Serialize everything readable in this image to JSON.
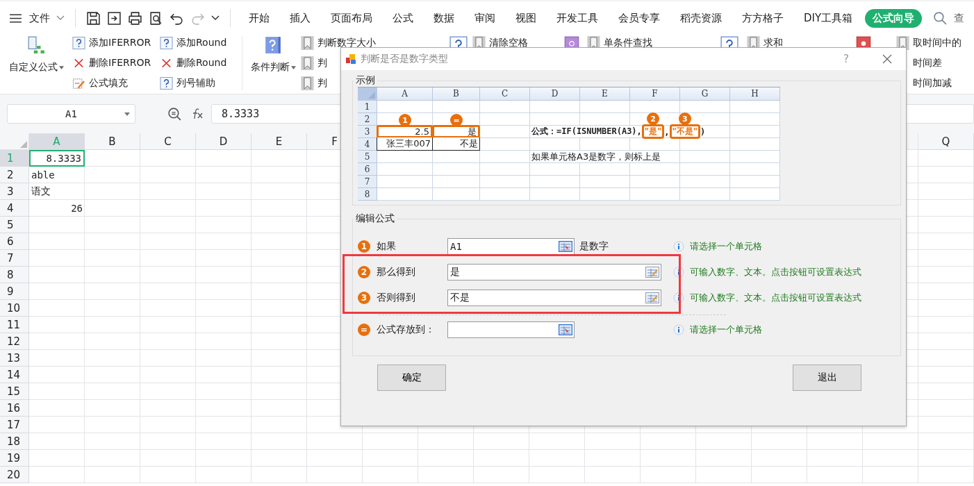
{
  "menu_bar": {
    "file_menu": "文件",
    "tabs": [
      {
        "label": "开始",
        "selected": false
      },
      {
        "label": "插入",
        "selected": false
      },
      {
        "label": "页面布局",
        "selected": false
      },
      {
        "label": "公式",
        "selected": false
      },
      {
        "label": "数据",
        "selected": false
      },
      {
        "label": "审阅",
        "selected": false
      },
      {
        "label": "视图",
        "selected": false
      },
      {
        "label": "开发工具",
        "selected": false
      },
      {
        "label": "会员专享",
        "selected": false
      },
      {
        "label": "稻壳资源",
        "selected": false
      },
      {
        "label": "方方格子",
        "selected": false
      },
      {
        "label": "DIY工具箱",
        "selected": false
      },
      {
        "label": "公式向导",
        "selected": true
      }
    ],
    "search_label": "查"
  },
  "ribbon": {
    "custom_formula": "自定义公式",
    "condition": "条件判断",
    "small_columns": [
      [
        {
          "kind": "help",
          "label": "添加IFERROR"
        },
        {
          "kind": "delete",
          "label": "删除IFERROR"
        },
        {
          "kind": "fill",
          "label": "公式填充"
        }
      ],
      [
        {
          "kind": "help",
          "label": "添加Round"
        },
        {
          "kind": "delete",
          "label": "删除Round"
        },
        {
          "kind": "help",
          "label": "列号辅助"
        }
      ]
    ],
    "judge_items": [
      "判断数字大小",
      "判",
      "判"
    ],
    "right_items": [
      {
        "kind": "help"
      },
      {
        "kind": "bookmark",
        "label": "清除空格"
      },
      {
        "kind": "book"
      },
      {
        "kind": "bookmark",
        "label": "单条件查找"
      },
      {
        "kind": "help"
      },
      {
        "kind": "bookmark",
        "label": "求和"
      },
      {
        "kind": "redbook"
      }
    ],
    "time_items": [
      "取时间中的",
      "时间差",
      "时间加减"
    ]
  },
  "sheet": {
    "name_box": "A1",
    "formula": "8.3333",
    "columns": [
      {
        "label": "A",
        "selected": true
      },
      {
        "label": "B",
        "selected": false
      },
      {
        "label": "C",
        "selected": false
      },
      {
        "label": "D",
        "selected": false
      },
      {
        "label": "E",
        "selected": false
      },
      {
        "label": "F",
        "selected": false
      }
    ],
    "right_columns": [
      {
        "label": "Q",
        "selected": false
      }
    ],
    "rows": [
      {
        "number": "1",
        "selected": true,
        "value": "8.3333",
        "right_aligned": true
      },
      {
        "number": "2",
        "selected": false,
        "value": "able",
        "right_aligned": false
      },
      {
        "number": "3",
        "selected": false,
        "value": "语文",
        "right_aligned": false
      },
      {
        "number": "4",
        "selected": false,
        "value": "26",
        "right_aligned": true
      },
      {
        "number": "5",
        "selected": false
      },
      {
        "number": "6",
        "selected": false
      },
      {
        "number": "7",
        "selected": false
      },
      {
        "number": "8",
        "selected": false
      },
      {
        "number": "9",
        "selected": false
      },
      {
        "number": "10",
        "selected": false
      },
      {
        "number": "11",
        "selected": false
      },
      {
        "number": "12",
        "selected": false
      },
      {
        "number": "13",
        "selected": false
      },
      {
        "number": "14",
        "selected": false
      },
      {
        "number": "15",
        "selected": false
      },
      {
        "number": "16",
        "selected": false
      },
      {
        "number": "17",
        "selected": false
      },
      {
        "number": "18",
        "selected": false
      },
      {
        "number": "19",
        "selected": false
      },
      {
        "number": "20",
        "selected": false
      }
    ]
  },
  "dialog": {
    "title": "判断是否是数字类型",
    "help": "?",
    "example": {
      "legend": "示例",
      "columns": [
        "A",
        "B",
        "C",
        "D",
        "E",
        "F",
        "G",
        "H"
      ],
      "rows": [
        {
          "number": "1"
        },
        {
          "number": "2"
        },
        {
          "number": "3",
          "cells": [
            {
              "text": "2.5",
              "right_aligned": true,
              "marked": true,
              "badge": "1"
            },
            {
              "text": "是",
              "right_aligned": true,
              "marked": true,
              "badge": "="
            },
            {},
            {
              "kind": "formula",
              "parts": [
                {
                  "text": "公式：=IF(ISNUMBER(A3),",
                  "marked": false
                },
                {
                  "text": "\"是\"",
                  "marked": true,
                  "badge": "2"
                },
                {
                  "text": ",",
                  "marked": false
                },
                {
                  "text": "\"不是\"",
                  "marked": true,
                  "badge": "3"
                },
                {
                  "text": ")",
                  "marked": false
                }
              ]
            }
          ]
        },
        {
          "number": "4",
          "cells": [
            {
              "text": "张三丰007",
              "right_aligned": true,
              "marked": false,
              "bordered": true
            },
            {
              "text": "不是",
              "right_aligned": true,
              "marked": false,
              "bordered": true
            }
          ]
        },
        {
          "number": "5",
          "cells": [
            {},
            {},
            {},
            {
              "text": "如果单元格A3是数字，则标上是",
              "right_aligned": false,
              "marked": false,
              "bordered": false
            }
          ]
        },
        {
          "number": "6"
        },
        {
          "number": "7"
        },
        {
          "number": "8"
        }
      ]
    },
    "editor": {
      "legend": "编辑公式",
      "rows": [
        {
          "badge": "1",
          "label": "如果",
          "value": "A1",
          "suffix": "是数字",
          "kind": "cell",
          "hint": "请选择一个单元格",
          "highlighted": false
        },
        {
          "badge": "2",
          "label": "那么得到",
          "value": "是",
          "kind": "expression",
          "hint": "可输入数字、文本。点击按钮可设置表达式",
          "highlighted": true
        },
        {
          "badge": "3",
          "label": "否则得到",
          "value": "不是",
          "kind": "expression",
          "hint": "可输入数字、文本。点击按钮可设置表达式",
          "highlighted": true
        },
        {
          "badge": "=",
          "label": "公式存放到：",
          "kind": "cell",
          "hint": "请选择一个单元格",
          "highlighted": false,
          "divider_before": true
        }
      ]
    },
    "buttons": [
      "确定",
      "退出"
    ]
  }
}
